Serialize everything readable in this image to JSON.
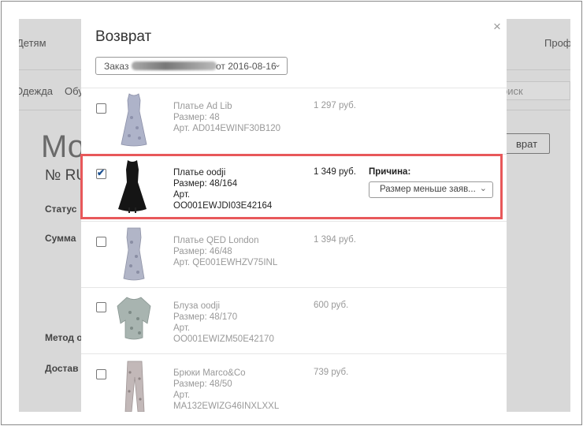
{
  "background": {
    "nav_children": "Детям",
    "nav_profile": "Профи",
    "cat_clothes": "Одежда",
    "cat_shoes": "Обу",
    "search_placeholder": "оиск",
    "page_title_partial": "Мо",
    "order_no_partial": "№ RU",
    "status_label": "Статус",
    "sum_label": "Сумма",
    "method_label": "Метод о",
    "delivery_label": "Достав",
    "return_button_partial": "врат"
  },
  "modal": {
    "title": "Возврат",
    "close_glyph": "×",
    "order_select": {
      "prefix": "Заказ",
      "suffix": "от 2016-08-16",
      "chevron": "⌄"
    },
    "reason_label": "Причина:",
    "reason_value": "Размер меньше заяв...",
    "items": [
      {
        "name": "Платье Ad Lib",
        "size": "Размер: 48",
        "article": "Арт. AD014EWINF30B120",
        "price": "1 297 руб.",
        "checked": false
      },
      {
        "name": "Платье oodji",
        "size": "Размер: 48/164",
        "article_label": "Арт.",
        "article_code": "OO001EWJDI03E42164",
        "price": "1 349 руб.",
        "checked": true
      },
      {
        "name": "Платье QED London",
        "size": "Размер: 46/48",
        "article": "Арт. QE001EWHZV75INL",
        "price": "1 394 руб.",
        "checked": false
      },
      {
        "name": "Блуза oodji",
        "size": "Размер: 48/170",
        "article_label": "Арт.",
        "article_code": "OO001EWIZM50E42170",
        "price": "600 руб.",
        "checked": false
      },
      {
        "name": "Брюки Marco&Co",
        "size": "Размер: 48/50",
        "article_label": "Арт.",
        "article_code": "MA132EWIZG46INXLXXL",
        "price": "739 руб.",
        "checked": false
      }
    ]
  },
  "colors": {
    "highlight": "#e8585a",
    "checkmark": "#1a4f8f"
  }
}
